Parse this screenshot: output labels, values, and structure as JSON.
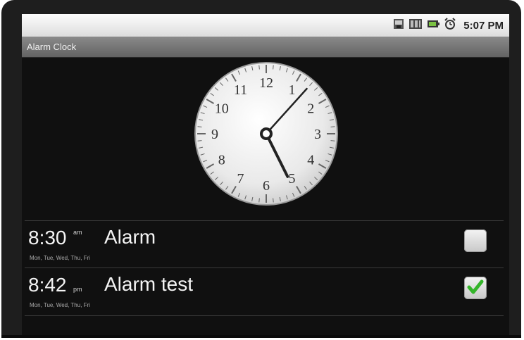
{
  "status_bar": {
    "time": "5:07 PM",
    "icons": [
      "usb-debug-icon",
      "sd-card-icon",
      "battery-icon",
      "alarm-icon"
    ]
  },
  "title_bar": {
    "title": "Alarm Clock"
  },
  "clock": {
    "numerals": [
      "12",
      "1",
      "2",
      "3",
      "4",
      "5",
      "6",
      "7",
      "8",
      "9",
      "10",
      "11"
    ],
    "hour": 5,
    "minute": 7,
    "face_color": "#eeeeee"
  },
  "alarms": [
    {
      "time": "8:30",
      "ampm": "am",
      "label": "Alarm",
      "days": "Mon, Tue, Wed, Thu, Fri",
      "enabled": false
    },
    {
      "time": "8:42",
      "ampm": "pm",
      "label": "Alarm test",
      "days": "Mon, Tue, Wed, Thu, Fri",
      "enabled": true
    }
  ],
  "colors": {
    "check": "#34b52a",
    "background": "#101010"
  }
}
